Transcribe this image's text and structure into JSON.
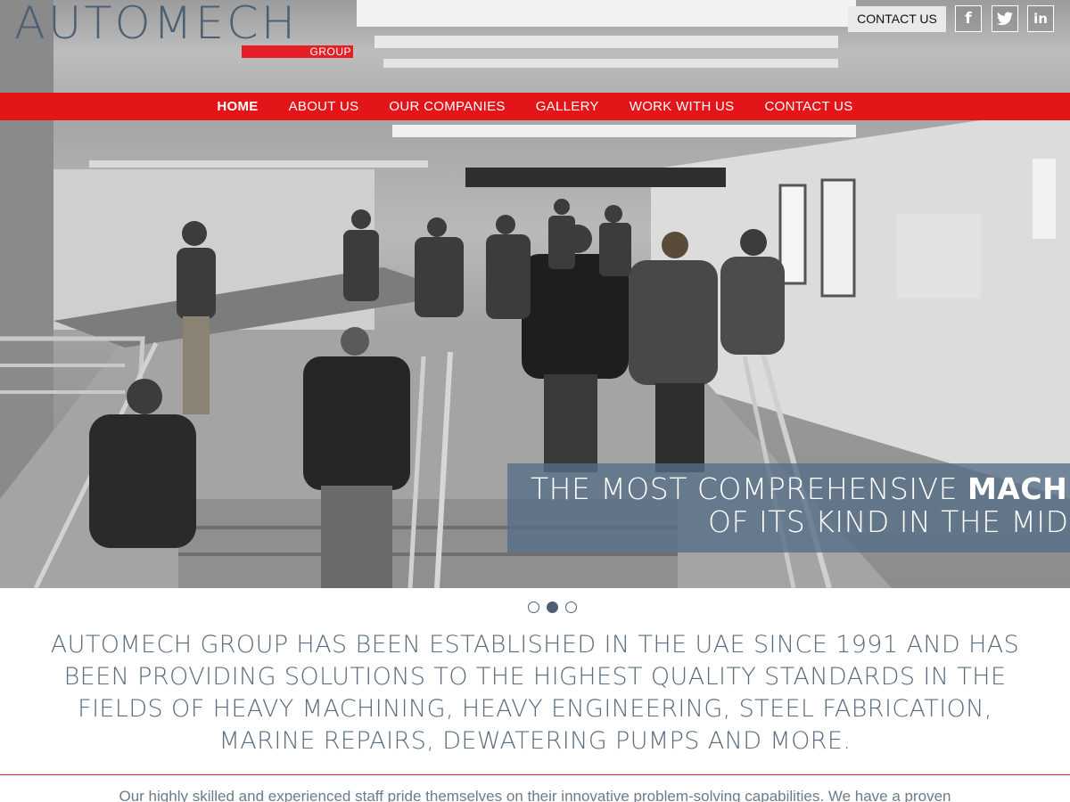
{
  "header": {
    "logo_text": "AUTOMECH",
    "logo_subtext": "GROUP",
    "contact_button": "CONTACT US",
    "social": [
      {
        "name": "facebook",
        "icon": "facebook-icon",
        "glyph": "f"
      },
      {
        "name": "twitter",
        "icon": "twitter-icon"
      },
      {
        "name": "linkedin",
        "icon": "linkedin-icon",
        "glyph": "in"
      }
    ]
  },
  "nav": {
    "items": [
      "HOME",
      "ABOUT US",
      "OUR COMPANIES",
      "GALLERY",
      "WORK WITH US",
      "CONTACT US"
    ],
    "active_index": 0
  },
  "hero": {
    "caption_line1_normal": "THE MOST COMPREHENSIVE ",
    "caption_line1_bold": "MACH",
    "caption_line2": "OF ITS KIND IN THE MID"
  },
  "slider": {
    "dot_count": 3,
    "active_index": 1
  },
  "intro": {
    "text": "AUTOMECH GROUP HAS BEEN ESTABLISHED IN THE UAE SINCE 1991 AND HAS BEEN PROVIDING SOLUTIONS TO THE HIGHEST QUALITY STANDARDS IN THE FIELDS OF HEAVY MACHINING, HEAVY ENGINEERING, STEEL FABRICATION, MARINE REPAIRS, DEWATERING PUMPS AND MORE.",
    "body_partial": "Our highly skilled and experienced staff pride themselves on their innovative problem-solving capabilities. We have a proven"
  },
  "colors": {
    "brand_red": "#e31519",
    "brand_slate": "#4e6074",
    "caption_overlay": "#566e86"
  }
}
